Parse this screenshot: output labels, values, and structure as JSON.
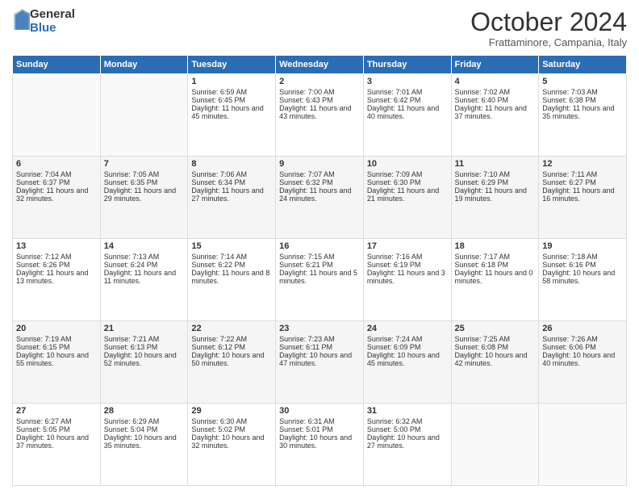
{
  "logo": {
    "general": "General",
    "blue": "Blue"
  },
  "header": {
    "month": "October 2024",
    "location": "Frattaminore, Campania, Italy"
  },
  "weekdays": [
    "Sunday",
    "Monday",
    "Tuesday",
    "Wednesday",
    "Thursday",
    "Friday",
    "Saturday"
  ],
  "weeks": [
    [
      {
        "day": "",
        "info": ""
      },
      {
        "day": "",
        "info": ""
      },
      {
        "day": "1",
        "info": "Sunrise: 6:59 AM\nSunset: 6:45 PM\nDaylight: 11 hours and 45 minutes."
      },
      {
        "day": "2",
        "info": "Sunrise: 7:00 AM\nSunset: 6:43 PM\nDaylight: 11 hours and 43 minutes."
      },
      {
        "day": "3",
        "info": "Sunrise: 7:01 AM\nSunset: 6:42 PM\nDaylight: 11 hours and 40 minutes."
      },
      {
        "day": "4",
        "info": "Sunrise: 7:02 AM\nSunset: 6:40 PM\nDaylight: 11 hours and 37 minutes."
      },
      {
        "day": "5",
        "info": "Sunrise: 7:03 AM\nSunset: 6:38 PM\nDaylight: 11 hours and 35 minutes."
      }
    ],
    [
      {
        "day": "6",
        "info": "Sunrise: 7:04 AM\nSunset: 6:37 PM\nDaylight: 11 hours and 32 minutes."
      },
      {
        "day": "7",
        "info": "Sunrise: 7:05 AM\nSunset: 6:35 PM\nDaylight: 11 hours and 29 minutes."
      },
      {
        "day": "8",
        "info": "Sunrise: 7:06 AM\nSunset: 6:34 PM\nDaylight: 11 hours and 27 minutes."
      },
      {
        "day": "9",
        "info": "Sunrise: 7:07 AM\nSunset: 6:32 PM\nDaylight: 11 hours and 24 minutes."
      },
      {
        "day": "10",
        "info": "Sunrise: 7:09 AM\nSunset: 6:30 PM\nDaylight: 11 hours and 21 minutes."
      },
      {
        "day": "11",
        "info": "Sunrise: 7:10 AM\nSunset: 6:29 PM\nDaylight: 11 hours and 19 minutes."
      },
      {
        "day": "12",
        "info": "Sunrise: 7:11 AM\nSunset: 6:27 PM\nDaylight: 11 hours and 16 minutes."
      }
    ],
    [
      {
        "day": "13",
        "info": "Sunrise: 7:12 AM\nSunset: 6:26 PM\nDaylight: 11 hours and 13 minutes."
      },
      {
        "day": "14",
        "info": "Sunrise: 7:13 AM\nSunset: 6:24 PM\nDaylight: 11 hours and 11 minutes."
      },
      {
        "day": "15",
        "info": "Sunrise: 7:14 AM\nSunset: 6:22 PM\nDaylight: 11 hours and 8 minutes."
      },
      {
        "day": "16",
        "info": "Sunrise: 7:15 AM\nSunset: 6:21 PM\nDaylight: 11 hours and 5 minutes."
      },
      {
        "day": "17",
        "info": "Sunrise: 7:16 AM\nSunset: 6:19 PM\nDaylight: 11 hours and 3 minutes."
      },
      {
        "day": "18",
        "info": "Sunrise: 7:17 AM\nSunset: 6:18 PM\nDaylight: 11 hours and 0 minutes."
      },
      {
        "day": "19",
        "info": "Sunrise: 7:18 AM\nSunset: 6:16 PM\nDaylight: 10 hours and 58 minutes."
      }
    ],
    [
      {
        "day": "20",
        "info": "Sunrise: 7:19 AM\nSunset: 6:15 PM\nDaylight: 10 hours and 55 minutes."
      },
      {
        "day": "21",
        "info": "Sunrise: 7:21 AM\nSunset: 6:13 PM\nDaylight: 10 hours and 52 minutes."
      },
      {
        "day": "22",
        "info": "Sunrise: 7:22 AM\nSunset: 6:12 PM\nDaylight: 10 hours and 50 minutes."
      },
      {
        "day": "23",
        "info": "Sunrise: 7:23 AM\nSunset: 6:11 PM\nDaylight: 10 hours and 47 minutes."
      },
      {
        "day": "24",
        "info": "Sunrise: 7:24 AM\nSunset: 6:09 PM\nDaylight: 10 hours and 45 minutes."
      },
      {
        "day": "25",
        "info": "Sunrise: 7:25 AM\nSunset: 6:08 PM\nDaylight: 10 hours and 42 minutes."
      },
      {
        "day": "26",
        "info": "Sunrise: 7:26 AM\nSunset: 6:06 PM\nDaylight: 10 hours and 40 minutes."
      }
    ],
    [
      {
        "day": "27",
        "info": "Sunrise: 6:27 AM\nSunset: 5:05 PM\nDaylight: 10 hours and 37 minutes."
      },
      {
        "day": "28",
        "info": "Sunrise: 6:29 AM\nSunset: 5:04 PM\nDaylight: 10 hours and 35 minutes."
      },
      {
        "day": "29",
        "info": "Sunrise: 6:30 AM\nSunset: 5:02 PM\nDaylight: 10 hours and 32 minutes."
      },
      {
        "day": "30",
        "info": "Sunrise: 6:31 AM\nSunset: 5:01 PM\nDaylight: 10 hours and 30 minutes."
      },
      {
        "day": "31",
        "info": "Sunrise: 6:32 AM\nSunset: 5:00 PM\nDaylight: 10 hours and 27 minutes."
      },
      {
        "day": "",
        "info": ""
      },
      {
        "day": "",
        "info": ""
      }
    ]
  ]
}
